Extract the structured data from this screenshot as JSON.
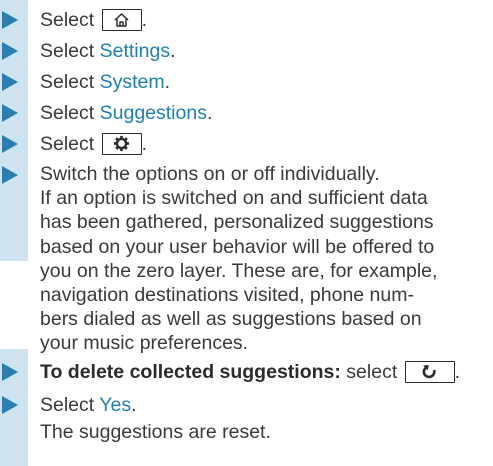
{
  "steps": [
    {
      "prefix": "Select",
      "key_icon": "home-icon",
      "suffix": "."
    },
    {
      "prefix": "Select",
      "link": "Settings",
      "suffix": "."
    },
    {
      "prefix": "Select",
      "link": "System",
      "suffix": "."
    },
    {
      "prefix": "Select",
      "link": "Suggestions",
      "suffix": "."
    },
    {
      "prefix": "Select",
      "key_icon": "gear-icon",
      "suffix": "."
    },
    {
      "lines": [
        "Switch the options on or off individually.",
        "If an option is switched on and sufficient data",
        "has been gathered, personalized suggestions",
        "based on your user behavior will be offered to",
        "you on the zero layer. These are, for example,",
        "navigation destinations visited, phone num-",
        "bers dialed as well as suggestions based on",
        "your music preferences."
      ]
    },
    {
      "bold_prefix": "To delete collected suggestions:",
      "prefix": "select",
      "key_icon": "reset-icon",
      "suffix": "."
    },
    {
      "prefix": "Select",
      "link": "Yes",
      "suffix": ".",
      "result": "The suggestions are reset."
    }
  ],
  "colors": {
    "accent": "#1f7fb2",
    "bullet": "#2a7fb0",
    "bar": "#cfe3f0",
    "text": "#3a3a3a"
  }
}
